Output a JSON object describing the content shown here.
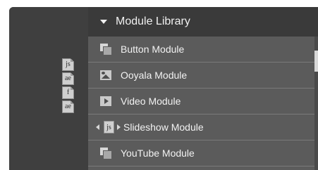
{
  "panel": {
    "title": "Module Library"
  },
  "file_icons": [
    {
      "name": "js-file-icon",
      "label": "js"
    },
    {
      "name": "ae-file-icon",
      "label": "ae"
    },
    {
      "name": "f-file-icon",
      "label": "f"
    },
    {
      "name": "ae-file-icon",
      "label": "ae"
    }
  ],
  "modules": [
    {
      "label": "Button Module",
      "icon": "module-icon"
    },
    {
      "label": "Ooyala Module",
      "icon": "image-icon"
    },
    {
      "label": "Video Module",
      "icon": "play-icon"
    },
    {
      "label": "Slideshow Module",
      "icon": "js-file-icon"
    },
    {
      "label": "YouTube Module",
      "icon": "module-icon"
    }
  ],
  "drag_icon_label": "js"
}
